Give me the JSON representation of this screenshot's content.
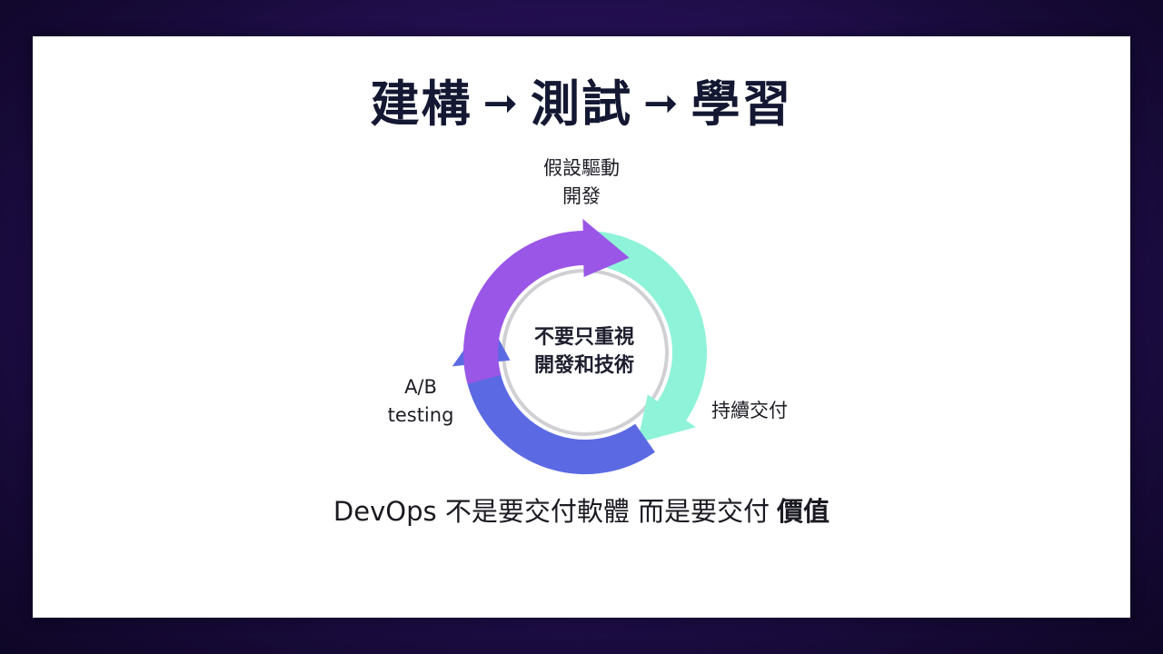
{
  "title": {
    "part1": "建構",
    "part2": "測試",
    "part3": "學習",
    "arrow_glyph": "➞"
  },
  "cycle": {
    "top_label_line1": "假設驅動",
    "top_label_line2": "開發",
    "right_label": "持續交付",
    "left_label_line1": "A/B",
    "left_label_line2": "testing",
    "center_line1": "不要只重視",
    "center_line2": "開發和技術",
    "colors": {
      "mint": "#8ef3d8",
      "purple": "#9a56e6",
      "blue": "#5b6ae3",
      "ring": "#d0d0d4"
    }
  },
  "tagline": {
    "text": "DevOps 不是要交付軟體 而是要交付",
    "emphasis": "價值"
  }
}
